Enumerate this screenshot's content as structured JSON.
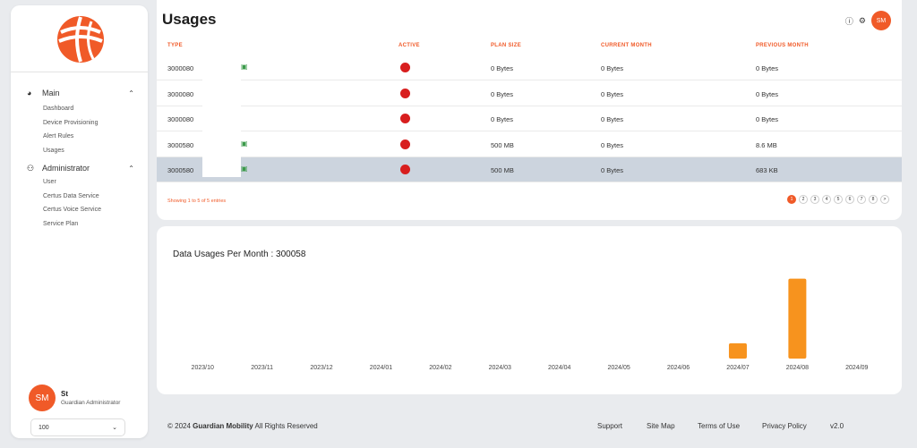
{
  "sidebar": {
    "main_label": "Main",
    "main_items": [
      "Dashboard",
      "Device Provisioning",
      "Alert Rules",
      "Usages"
    ],
    "admin_label": "Administrator",
    "admin_items": [
      "User",
      "Certus Data Service",
      "Certus Voice Service",
      "Service Plan"
    ],
    "user_initials": "SM",
    "user_name": "St",
    "user_role": "Guardian Administrator",
    "page_size": "100"
  },
  "header": {
    "title": "Usages",
    "avatar_initials": "SM"
  },
  "table": {
    "columns": [
      "TYPE",
      "ACTIVE",
      "PLAN SIZE",
      "CURRENT MONTH",
      "PREVIOUS MONTH"
    ],
    "rows": [
      {
        "type": "3000080",
        "plan": "0 Bytes",
        "current": "0 Bytes",
        "previous": "0 Bytes",
        "sim": true
      },
      {
        "type": "3000080",
        "plan": "0 Bytes",
        "current": "0 Bytes",
        "previous": "0 Bytes",
        "sim": false
      },
      {
        "type": "3000080",
        "plan": "0 Bytes",
        "current": "0 Bytes",
        "previous": "0 Bytes",
        "sim": false
      },
      {
        "type": "3000580",
        "plan": "500 MB",
        "current": "0 Bytes",
        "previous": "8.6 MB",
        "sim": true
      },
      {
        "type": "3000580",
        "plan": "500 MB",
        "current": "0 Bytes",
        "previous": "683 KB",
        "sim": true
      }
    ],
    "showing_text": "Showing 1 to 5 of 5 entries",
    "pages": [
      "1",
      "2",
      "3",
      "4",
      "5",
      "6",
      "7",
      "8",
      ">"
    ],
    "active_page": "1",
    "active_color": "#d81e1e"
  },
  "chart_data": {
    "type": "bar",
    "title": "Data Usages Per Month :  300058",
    "categories": [
      "2023/10",
      "2023/11",
      "2023/12",
      "2024/01",
      "2024/02",
      "2024/03",
      "2024/04",
      "2024/05",
      "2024/06",
      "2024/07",
      "2024/08",
      "2024/09"
    ],
    "values": [
      0,
      0,
      0,
      0,
      0,
      0,
      0,
      0,
      0,
      1.3,
      6.8,
      0
    ],
    "ylim": [
      0,
      7
    ],
    "bar_color": "#f7931e",
    "grid": false
  },
  "footer": {
    "copyright_prefix": "© 2024",
    "company": "Guardian Mobility",
    "rights": "All Rights Reserved",
    "links": [
      "Support",
      "Site Map",
      "Terms of Use",
      "Privacy Policy"
    ],
    "version": "v2.0"
  },
  "colors": {
    "accent": "#f05a28",
    "selected_row": "#ccd4de"
  }
}
